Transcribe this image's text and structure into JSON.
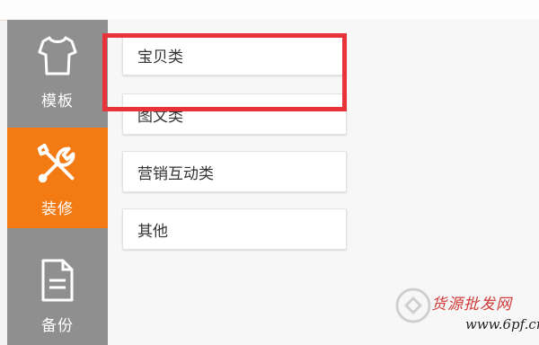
{
  "sidebar": {
    "items": [
      {
        "label": "模板",
        "icon": "shirt-icon"
      },
      {
        "label": "装修",
        "icon": "tools-icon",
        "active": true
      },
      {
        "label": "备份",
        "icon": "document-icon"
      }
    ]
  },
  "categories": [
    {
      "label": "宝贝类"
    },
    {
      "label": "图文类"
    },
    {
      "label": "营销互动类"
    },
    {
      "label": "其他"
    }
  ],
  "watermark": {
    "title": "货源批发网",
    "url": "www.6pf.cn"
  },
  "colors": {
    "accent": "#f47a14",
    "sidebar": "#8f8f8f",
    "highlight": "#e8333a"
  }
}
